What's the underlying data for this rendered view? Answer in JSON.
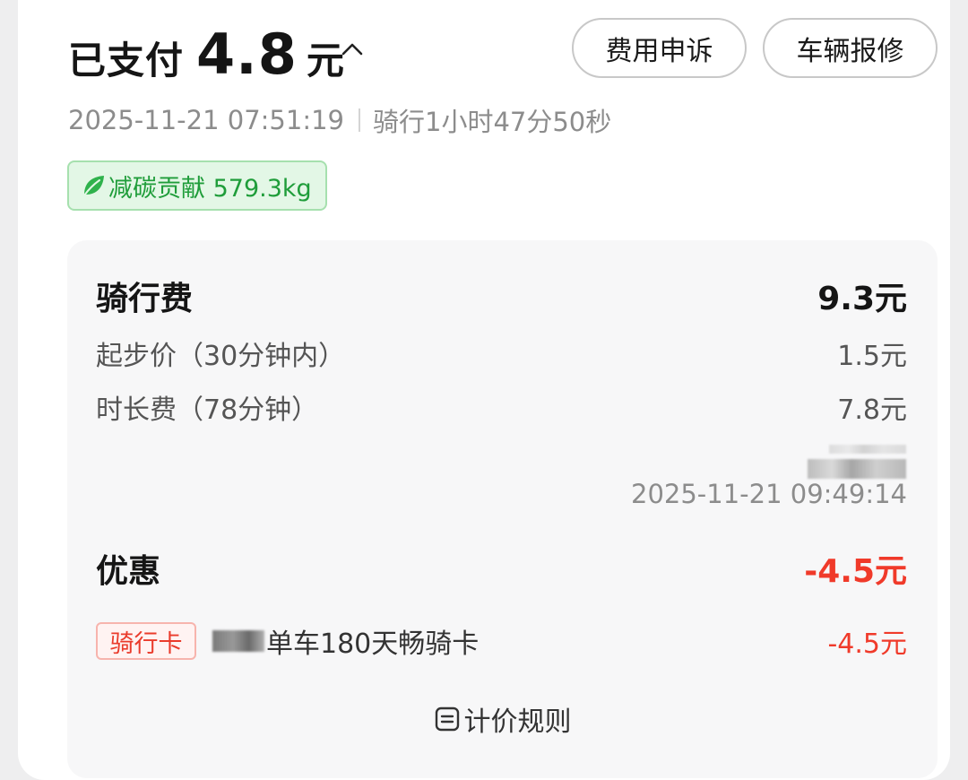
{
  "header": {
    "paid_label": "已支付",
    "paid_amount": "4.8",
    "paid_unit": "元",
    "appeal_button": "费用申诉",
    "repair_button": "车辆报修"
  },
  "meta": {
    "datetime": "2025-11-21 07:51:19",
    "duration": "骑行1小时47分50秒"
  },
  "carbon": {
    "label": "减碳贡献 579.3kg",
    "icon": "leaf-icon"
  },
  "ride_fee": {
    "title": "骑行费",
    "total": "9.3元",
    "items": [
      {
        "label": "起步价（30分钟内）",
        "value": "1.5元"
      },
      {
        "label": "时长费（78分钟）",
        "value": "7.8元"
      }
    ],
    "timestamp": "2025-11-21 09:49:14"
  },
  "discount": {
    "title": "优惠",
    "total": "-4.5元",
    "items": [
      {
        "tag": "骑行卡",
        "name": "单车180天畅骑卡",
        "value": "-4.5元"
      }
    ]
  },
  "rules_link": "计价规则",
  "colors": {
    "accent_red": "#f03a2a",
    "carbon_green": "#1f9d3a",
    "panel_bg": "#f7f7f8"
  }
}
